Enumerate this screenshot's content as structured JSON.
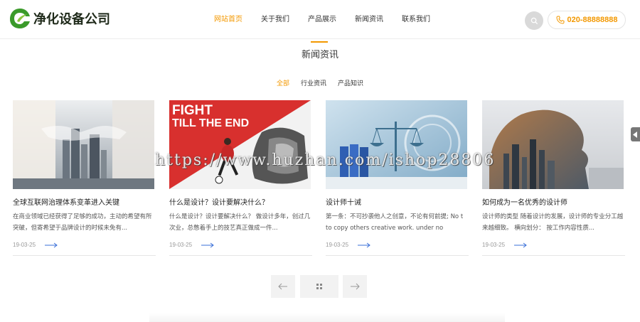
{
  "brand": {
    "name": "净化设备公司",
    "accent": "#f39800",
    "logo_green": "#3a9a2a"
  },
  "nav": {
    "items": [
      {
        "label": "网站首页",
        "active": true
      },
      {
        "label": "关于我们",
        "active": false
      },
      {
        "label": "产品展示",
        "active": false
      },
      {
        "label": "新闻资讯",
        "active": false
      },
      {
        "label": "联系我们",
        "active": false
      }
    ]
  },
  "header": {
    "search_icon": "search-icon",
    "phone_icon": "phone-icon",
    "phone": "020-88888888"
  },
  "section": {
    "title": "新闻资讯"
  },
  "filters": [
    {
      "label": "全部",
      "active": true
    },
    {
      "label": "行业资讯",
      "active": false
    },
    {
      "label": "产品知识",
      "active": false
    }
  ],
  "cards": [
    {
      "title": "全球互联网治理体系变革进入关键",
      "desc": "在商业领域已经获得了足够的成功，主动的希望有所突破，但寄希望于品牌设计的时候未免有...",
      "date": "19-03-25",
      "image": "business-handshake-city"
    },
    {
      "title": "什么是设计？设计要解决什么？",
      "desc": "什么是设计？设计要解决什么？ 做设计多年，创过几次业，总憋着手上的技艺真正做成一件...",
      "date": "19-03-25",
      "image": "fight-till-the-end-poster",
      "image_text_1": "FIGHT",
      "image_text_2": "TILL THE END"
    },
    {
      "title": "设计师十诫",
      "desc": "第一条：不可抄袭他人之创意，不论有何前提; No t to copy others creative work. under no circumsta",
      "date": "19-03-25",
      "image": "scales-of-justice"
    },
    {
      "title": "如何成为一名优秀的设计师",
      "desc": "设计师的类型 随着设计的发展，设计师的专业分工越来越细致。 横向划分： 按工作内容性质...",
      "date": "19-03-25",
      "image": "double-exposure-city-silhouette"
    }
  ],
  "pager": {
    "prev_icon": "arrow-left-icon",
    "grid_icon": "grid-dots-icon",
    "next_icon": "arrow-right-icon"
  },
  "side_tab": {
    "icon": "caret-left-icon"
  },
  "watermark": "https://www.huzhan.com/ishop28806"
}
